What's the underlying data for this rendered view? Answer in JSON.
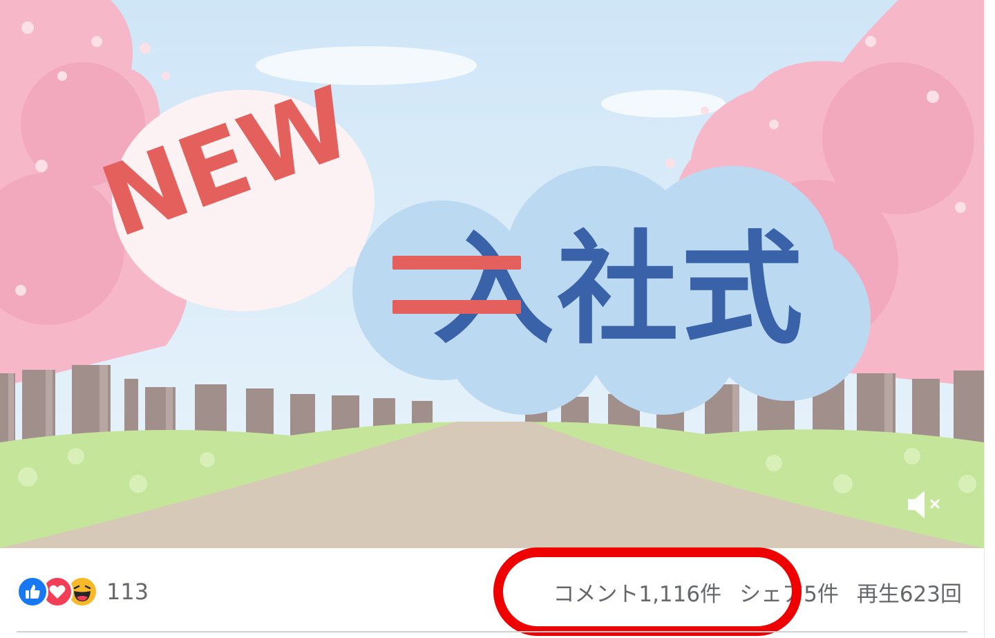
{
  "video": {
    "new_label": "NEW",
    "title": "入社式",
    "mute_icon": "volume-muted-icon"
  },
  "reactions": {
    "icons": [
      "like-icon",
      "love-icon",
      "haha-icon"
    ],
    "count": "113"
  },
  "stats": {
    "comments": "コメント1,116件",
    "shares": "シェア5件",
    "views": "再生623回"
  },
  "colors": {
    "highlight": "#ee0000",
    "like": "#1877f2",
    "love": "#f33e58",
    "haha": "#f7b928",
    "stat_text": "#65676b"
  }
}
